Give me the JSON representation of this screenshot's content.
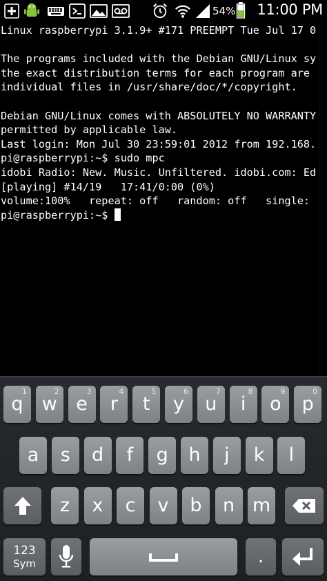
{
  "status_bar": {
    "time": "11:00 PM",
    "battery_percent": "54%",
    "icons": [
      "plus-icon",
      "android-icon",
      "keyboard-icon",
      "terminal-icon",
      "image-icon",
      "voicemail-icon",
      "alarm-icon",
      "wifi-icon",
      "signal-icon",
      "battery-icon"
    ]
  },
  "terminal": {
    "lines": [
      "Linux raspberrypi 3.1.9+ #171 PREEMPT Tue Jul 17 0",
      "",
      "The programs included with the Debian GNU/Linux sy",
      "the exact distribution terms for each program are",
      "individual files in /usr/share/doc/*/copyright.",
      "",
      "Debian GNU/Linux comes with ABSOLUTELY NO WARRANTY",
      "permitted by applicable law.",
      "Last login: Mon Jul 30 23:59:01 2012 from 192.168.",
      "pi@raspberrypi:~$ sudo mpc",
      "idobi Radio: New. Music. Unfiltered. idobi.com: Ed",
      "[playing] #14/19   17:41/0:00 (0%)",
      "volume:100%   repeat: off   random: off   single:"
    ],
    "prompt": "pi@raspberrypi:~$ "
  },
  "keyboard": {
    "row1": [
      {
        "label": "q",
        "hint": "1"
      },
      {
        "label": "w",
        "hint": "2"
      },
      {
        "label": "e",
        "hint": "3"
      },
      {
        "label": "r",
        "hint": "4"
      },
      {
        "label": "t",
        "hint": "5"
      },
      {
        "label": "y",
        "hint": "6"
      },
      {
        "label": "u",
        "hint": "7"
      },
      {
        "label": "i",
        "hint": "8"
      },
      {
        "label": "o",
        "hint": "9"
      },
      {
        "label": "p",
        "hint": "0"
      }
    ],
    "row2": [
      "a",
      "s",
      "d",
      "f",
      "g",
      "h",
      "j",
      "k",
      "l"
    ],
    "row3": [
      "z",
      "x",
      "c",
      "v",
      "b",
      "n",
      "m"
    ],
    "sym_label_top": "123",
    "sym_label_bottom": "Sym",
    "period_label": "."
  }
}
